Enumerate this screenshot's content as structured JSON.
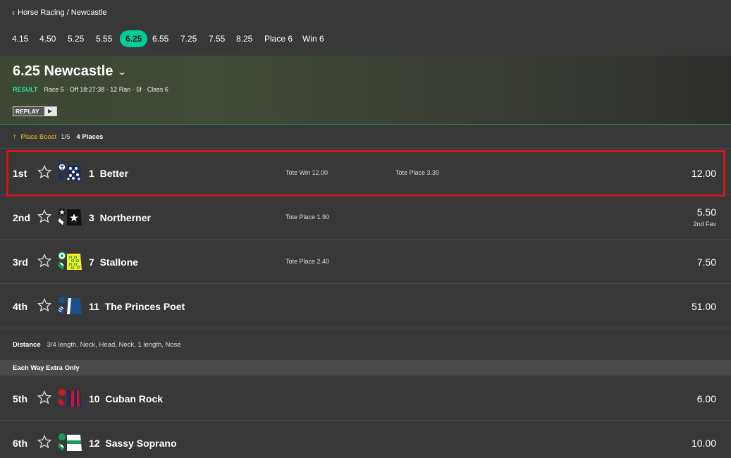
{
  "breadcrumb": "Horse Racing / Newcastle",
  "race_times": [
    "4.15",
    "4.50",
    "5.25",
    "5.55",
    "6.25",
    "6.55",
    "7.25",
    "7.55",
    "8.25",
    "Place 6",
    "Win 6"
  ],
  "active_time": "6.25",
  "race": {
    "title": "6.25 Newcastle",
    "status": "RESULT",
    "meta": "Race 5 · Off 18:27:38 · 12 Ran · 5f · Class 6",
    "replay_label": "REPLAY"
  },
  "boost": {
    "label": "Place Boost",
    "fraction": "1/5",
    "places": "4 Places"
  },
  "runners": [
    {
      "pos": "1st",
      "number": "1",
      "name": "Better",
      "tote_win": "Tote Win  12.00",
      "tote_place": "Tote Place  3.30",
      "price": "12.00",
      "fav": ""
    },
    {
      "pos": "2nd",
      "number": "3",
      "name": "Northerner",
      "tote_win": "Tote Place  1.90",
      "tote_place": "",
      "price": "5.50",
      "fav": "2nd Fav"
    },
    {
      "pos": "3rd",
      "number": "7",
      "name": "Stallone",
      "tote_win": "Tote Place  2.40",
      "tote_place": "",
      "price": "7.50",
      "fav": ""
    },
    {
      "pos": "4th",
      "number": "11",
      "name": "The Princes Poet",
      "tote_win": "",
      "tote_place": "",
      "price": "51.00",
      "fav": ""
    }
  ],
  "distance": {
    "label": "Distance",
    "value": "3/4 length, Neck, Head, Neck, 1 length, Nose"
  },
  "each_way_header": "Each Way Extra Only",
  "ew_runners": [
    {
      "pos": "5th",
      "number": "10",
      "name": "Cuban Rock",
      "price": "6.00"
    },
    {
      "pos": "6th",
      "number": "12",
      "name": "Sassy Soprano",
      "price": "10.00"
    }
  ],
  "colors": {
    "accent": "#00ce99",
    "result": "#2ee6a8",
    "boost": "#f0c020",
    "highlight": "#d4141e",
    "background": "#383838"
  }
}
